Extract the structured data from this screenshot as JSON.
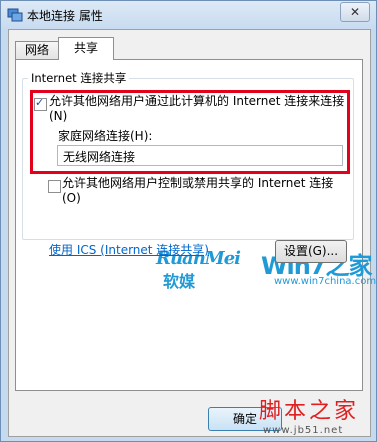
{
  "window": {
    "title": "本地连接 属性",
    "close_glyph": "✕"
  },
  "tabs": [
    {
      "label": "网络"
    },
    {
      "label": "共享"
    }
  ],
  "group": {
    "label": "Internet 连接共享"
  },
  "allow_connect": {
    "checked": true,
    "label": "允许其他网络用户通过此计算机的 Internet 连接来连接(N)"
  },
  "home_network": {
    "label": "家庭网络连接(H):",
    "value": "无线网络连接"
  },
  "allow_control": {
    "checked": false,
    "label": "允许其他网络用户控制或禁用共享的 Internet 连接(O)"
  },
  "ics_link": "使用 ICS (Internet 连接共享)",
  "settings_button": "设置(G)...",
  "logo": {
    "ruanmei": "RuanMei",
    "ruanmei_cn": "软媒",
    "win7": "Win7之家",
    "url": "www.win7china.com"
  },
  "ok_button": "确定",
  "watermark": {
    "text": "脚本之家",
    "url": "www.jb51.net"
  }
}
